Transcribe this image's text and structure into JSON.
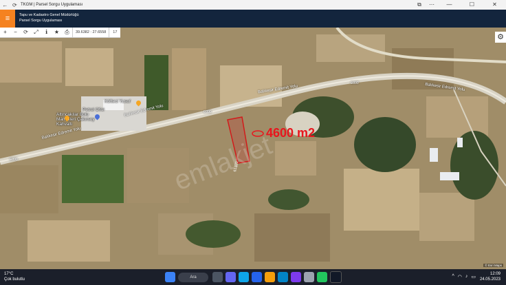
{
  "window": {
    "title": "TKGM | Parsel Sorgu Uygulaması"
  },
  "header": {
    "line1": "Tapu ve Kadastro Genel Müdürlüğü",
    "line2": "Parsel Sorgu Uygulaması"
  },
  "toolbar": {
    "coordinates": "39.6382 : 27.6558",
    "zoom": "17"
  },
  "map": {
    "road_label_1": "Balıkesir Edremit Yolu",
    "road_label_2": "Balıkesir Edremit Yolu",
    "road_shield_1": "E090",
    "road_shield_2": "E090",
    "road_shield_3": "E090",
    "poi_kofteci": "Köfteci Yusuf",
    "poi_petrol": "Petrol Ofisi",
    "poi_altincakilar_1": "Altıncakılar Bolu",
    "poi_altincakilar_2": "Mamulleri Çakırsoy",
    "poi_altincakilar_3": "Kahvaltı",
    "parcel_label": "61320",
    "area_annotation": "4600 m2",
    "watermark": "emlakjet",
    "attribution": "© Esri Maps"
  },
  "taskbar": {
    "temperature": "17°C",
    "weather": "Çok bulutlu",
    "search_label": "Ara",
    "time": "12:09",
    "date": "24.05.2023"
  }
}
